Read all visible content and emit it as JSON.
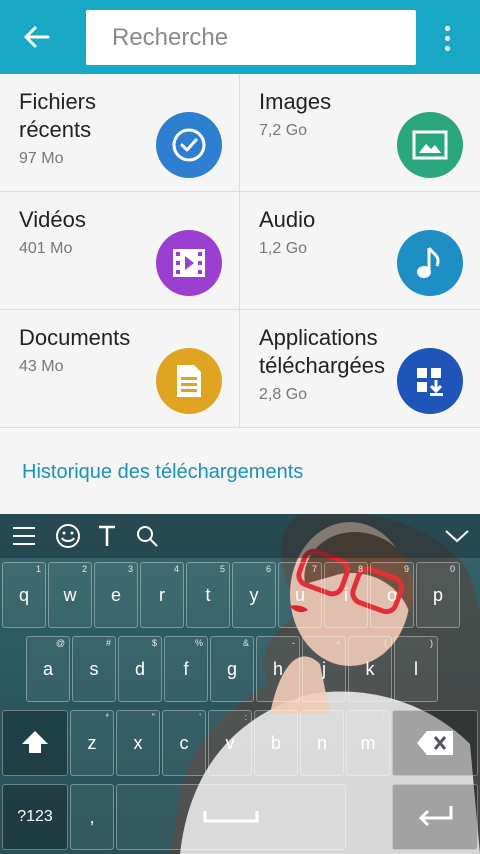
{
  "search": {
    "placeholder": "Recherche"
  },
  "categories": [
    {
      "name": "Fichiers\nrécents",
      "size": "97 Mo",
      "icon": "clock-check-icon",
      "color": "#2f7fd0"
    },
    {
      "name": "Images",
      "size": "7,2 Go",
      "icon": "image-icon",
      "color": "#2aa77f"
    },
    {
      "name": "Vidéos",
      "size": "401 Mo",
      "icon": "video-icon",
      "color": "#9b3fd1"
    },
    {
      "name": "Audio",
      "size": "1,2 Go",
      "icon": "music-note-icon",
      "color": "#1d8fc4"
    },
    {
      "name": "Documents",
      "size": "43 Mo",
      "icon": "document-icon",
      "color": "#e0a423"
    },
    {
      "name": "Applications\ntéléchargées",
      "size": "2,8 Go",
      "icon": "download-apps-icon",
      "color": "#1f55b8"
    }
  ],
  "history_link": "Historique des téléchargements",
  "keyboard": {
    "row1": [
      {
        "k": "q",
        "h": "1"
      },
      {
        "k": "w",
        "h": "2"
      },
      {
        "k": "e",
        "h": "3"
      },
      {
        "k": "r",
        "h": "4"
      },
      {
        "k": "t",
        "h": "5"
      },
      {
        "k": "y",
        "h": "6"
      },
      {
        "k": "u",
        "h": "7"
      },
      {
        "k": "i",
        "h": "8"
      },
      {
        "k": "o",
        "h": "9"
      },
      {
        "k": "p",
        "h": "0"
      }
    ],
    "row2": [
      {
        "k": "a",
        "h": "@"
      },
      {
        "k": "s",
        "h": "#"
      },
      {
        "k": "d",
        "h": "$"
      },
      {
        "k": "f",
        "h": "%"
      },
      {
        "k": "g",
        "h": "&"
      },
      {
        "k": "h",
        "h": "-"
      },
      {
        "k": "j",
        "h": "+"
      },
      {
        "k": "k",
        "h": "("
      },
      {
        "k": "l",
        "h": ")"
      }
    ],
    "row3": [
      {
        "k": "z",
        "h": "*"
      },
      {
        "k": "x",
        "h": "\""
      },
      {
        "k": "c",
        "h": "'"
      },
      {
        "k": "v",
        "h": ":"
      },
      {
        "k": "b",
        "h": ";"
      },
      {
        "k": "n",
        "h": "!"
      },
      {
        "k": "m",
        "h": "?"
      }
    ],
    "symbols_label": "?123",
    "comma_label": ","
  }
}
